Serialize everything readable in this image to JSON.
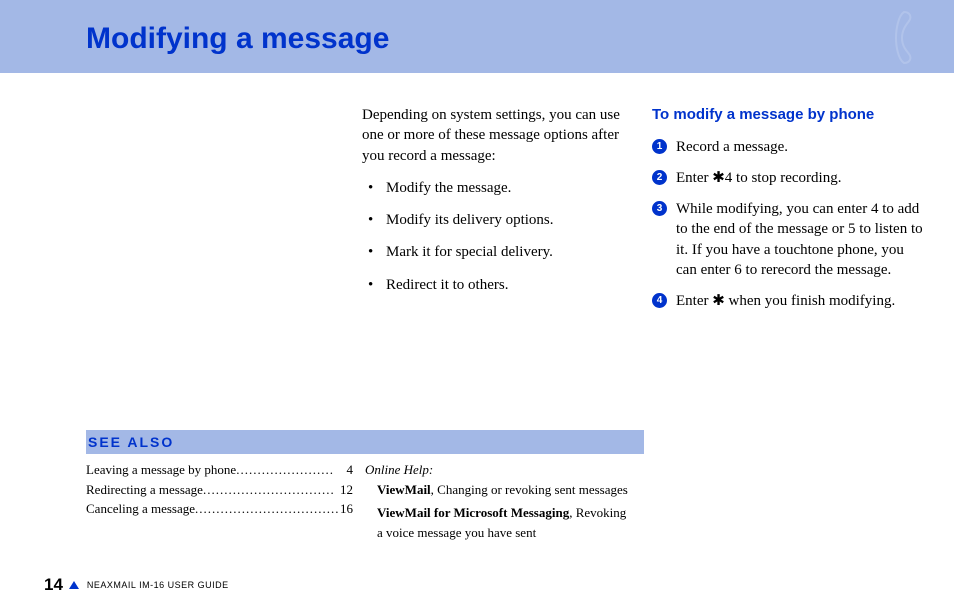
{
  "title": "Modifying a message",
  "intro": "Depending on system settings, you can use one or more of these message options after you record a message:",
  "options": [
    "Modify the message.",
    "Modify its delivery options.",
    "Mark it for special delivery.",
    "Redirect it to others."
  ],
  "subheading": "To modify a message by phone",
  "steps": [
    "Record a message.",
    "Enter ✱4 to stop recording.",
    "While modifying, you can enter 4 to add to the end of the message or 5 to listen to it. If you have a touchtone phone, you can enter 6 to rerecord the message.",
    "Enter ✱ when you finish modifying."
  ],
  "see_also": {
    "heading": "SEE ALSO",
    "refs": [
      {
        "label": "Leaving a message by phone",
        "page": "4"
      },
      {
        "label": "Redirecting a message",
        "page": "12"
      },
      {
        "label": "Canceling a message",
        "page": "16"
      }
    ],
    "online_help_label": "Online Help:",
    "online": [
      {
        "bold": "ViewMail",
        "rest": ", Changing or revoking sent messages"
      },
      {
        "bold": "ViewMail for Microsoft Messaging",
        "rest": ", Revoking a voice message you have sent"
      }
    ]
  },
  "footer": {
    "page": "14",
    "guide": "NEAXMAIL IM-16 USER GUIDE"
  }
}
